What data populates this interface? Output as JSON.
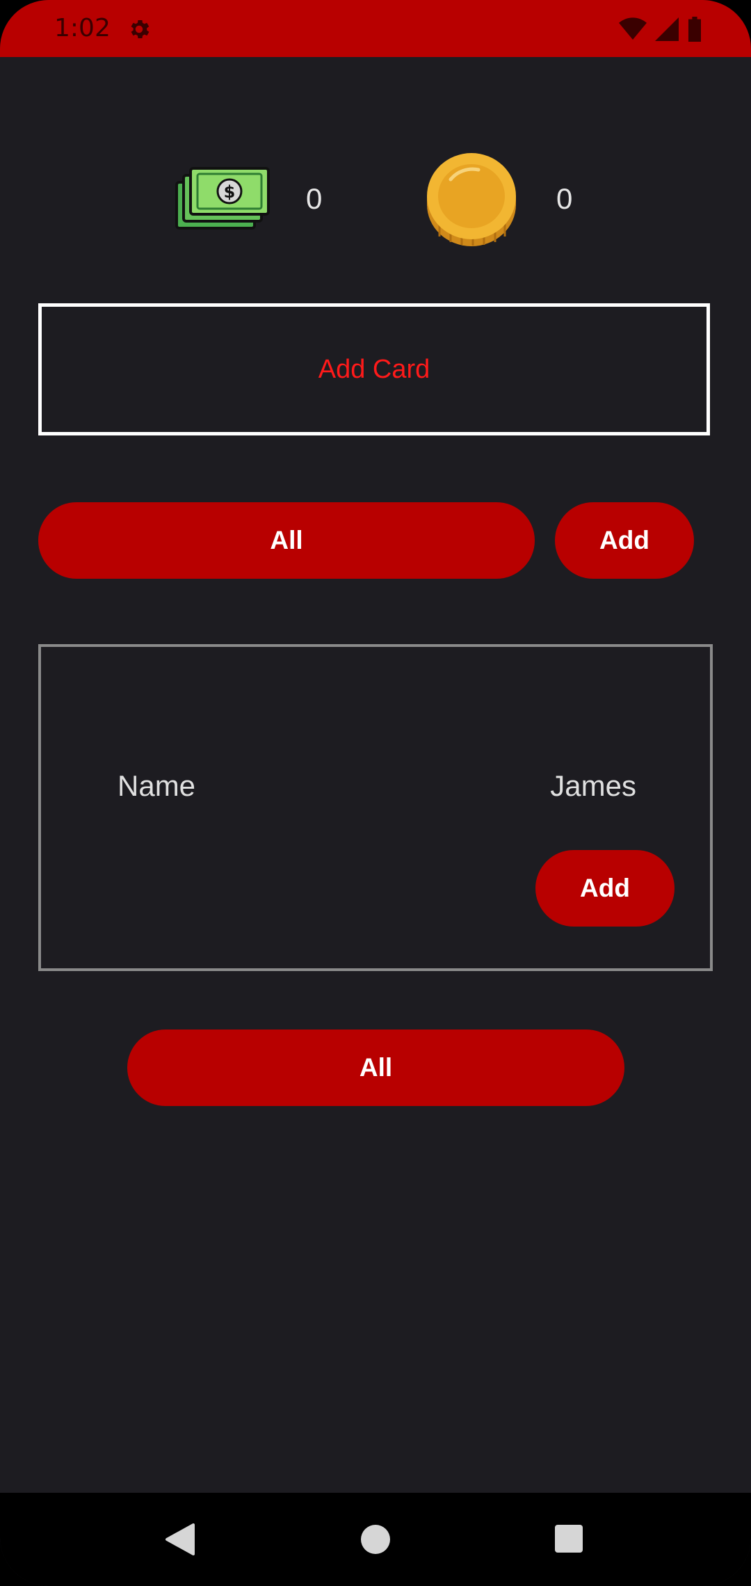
{
  "status_bar": {
    "time": "1:02",
    "icons": [
      "gear-icon",
      "wifi-icon",
      "signal-icon",
      "battery-icon"
    ],
    "color": "#b80000"
  },
  "wallet": {
    "cash_icon": "cash-icon",
    "cash_count": "0",
    "coin_icon": "coin-icon",
    "coin_count": "0"
  },
  "add_card": {
    "label": "Add Card",
    "color": "#ff1a1a"
  },
  "top_buttons": {
    "all_label": "All",
    "add_label": "Add"
  },
  "record": {
    "label": "Name",
    "value": "James",
    "add_label": "Add"
  },
  "bottom_button": {
    "all_label": "All"
  },
  "theme": {
    "accent": "#b80000",
    "background": "#1d1c21"
  },
  "nav_bar": {
    "icons": [
      "back-icon",
      "home-icon",
      "recents-icon"
    ]
  }
}
